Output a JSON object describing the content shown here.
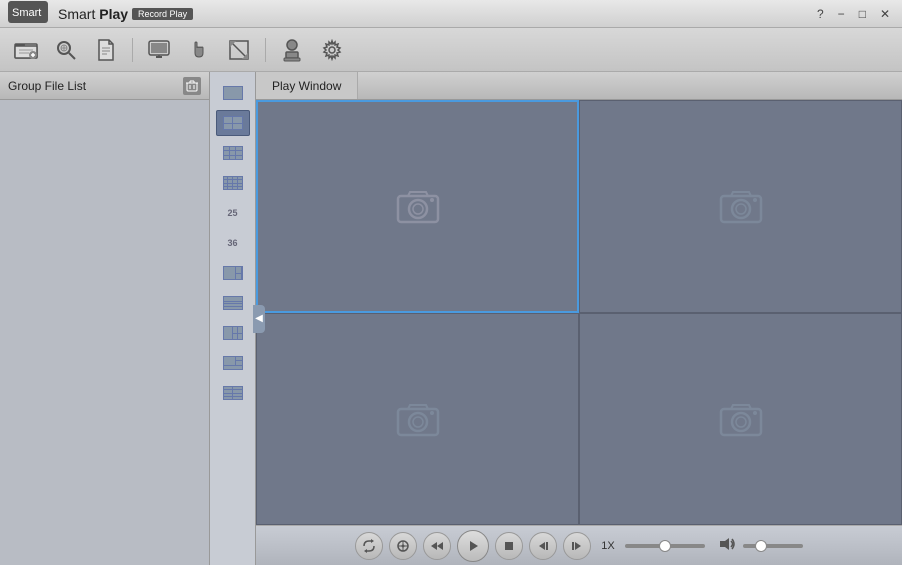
{
  "titleBar": {
    "appName": "Smart Play",
    "appNameBold": "Play",
    "subtitle": "Record Play",
    "controls": {
      "help": "?",
      "minimize": "−",
      "restore": "□",
      "close": "✕"
    }
  },
  "toolbar": {
    "buttons": [
      {
        "name": "open-file-btn",
        "icon": "📂",
        "label": "Open File"
      },
      {
        "name": "search-btn",
        "icon": "🔍",
        "label": "Search"
      },
      {
        "name": "document-btn",
        "icon": "📄",
        "label": "Document"
      },
      {
        "name": "monitor-btn",
        "icon": "🖥",
        "label": "Monitor"
      },
      {
        "name": "hand-btn",
        "icon": "✋",
        "label": "Pan"
      },
      {
        "name": "resize-btn",
        "icon": "⤢",
        "label": "Resize"
      },
      {
        "name": "stamp-btn",
        "icon": "👤",
        "label": "Stamp"
      },
      {
        "name": "settings-btn",
        "icon": "⚙",
        "label": "Settings"
      }
    ]
  },
  "sidebar": {
    "title": "Group File List",
    "deleteBtn": "🗑"
  },
  "layoutPanel": {
    "buttons": [
      {
        "name": "layout-1",
        "label": "1"
      },
      {
        "name": "layout-4",
        "label": "4",
        "active": true
      },
      {
        "name": "layout-9",
        "label": "9"
      },
      {
        "name": "layout-16",
        "label": "16"
      },
      {
        "name": "layout-25",
        "label": "25"
      },
      {
        "name": "layout-36",
        "label": "36"
      },
      {
        "name": "layout-special1",
        "label": "S1"
      },
      {
        "name": "layout-special2",
        "label": "S2"
      },
      {
        "name": "layout-special3",
        "label": "S3"
      },
      {
        "name": "layout-special4",
        "label": "S4"
      },
      {
        "name": "layout-file",
        "label": "F"
      }
    ],
    "collapseLabel": "◀"
  },
  "playWindow": {
    "tabLabel": "Play Window",
    "cells": [
      {
        "id": 1,
        "selected": true
      },
      {
        "id": 2,
        "selected": false
      },
      {
        "id": 3,
        "selected": false
      },
      {
        "id": 4,
        "selected": false
      }
    ]
  },
  "playbackBar": {
    "buttons": [
      {
        "name": "loop-btn",
        "icon": "↺"
      },
      {
        "name": "snapshot-btn",
        "icon": "⊕"
      },
      {
        "name": "rewind-btn",
        "icon": "↩"
      },
      {
        "name": "play-btn",
        "icon": "▶"
      },
      {
        "name": "stop-btn",
        "icon": "■"
      },
      {
        "name": "prev-frame-btn",
        "icon": "◀|"
      },
      {
        "name": "next-frame-btn",
        "icon": "|▶"
      }
    ],
    "speed": "1X",
    "volumeIcon": "🔊"
  }
}
